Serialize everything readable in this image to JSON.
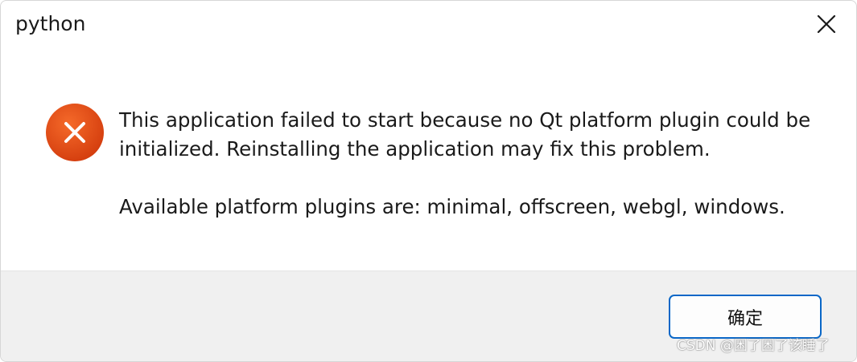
{
  "window": {
    "title": "python"
  },
  "close_button": {
    "icon": "close-icon"
  },
  "message": {
    "icon": "error-icon",
    "icon_color": "#e04a16",
    "line1": "This application failed to start because no Qt platform plugin could be",
    "line2": "initialized. Reinstalling the application may fix this problem.",
    "plugins": "Available platform plugins are: minimal, offscreen, webgl, windows."
  },
  "buttons": {
    "ok_label": "确定",
    "ok_border_color": "#0a67c7"
  },
  "watermark": {
    "text": "CSDN @困了困了该睡了"
  }
}
